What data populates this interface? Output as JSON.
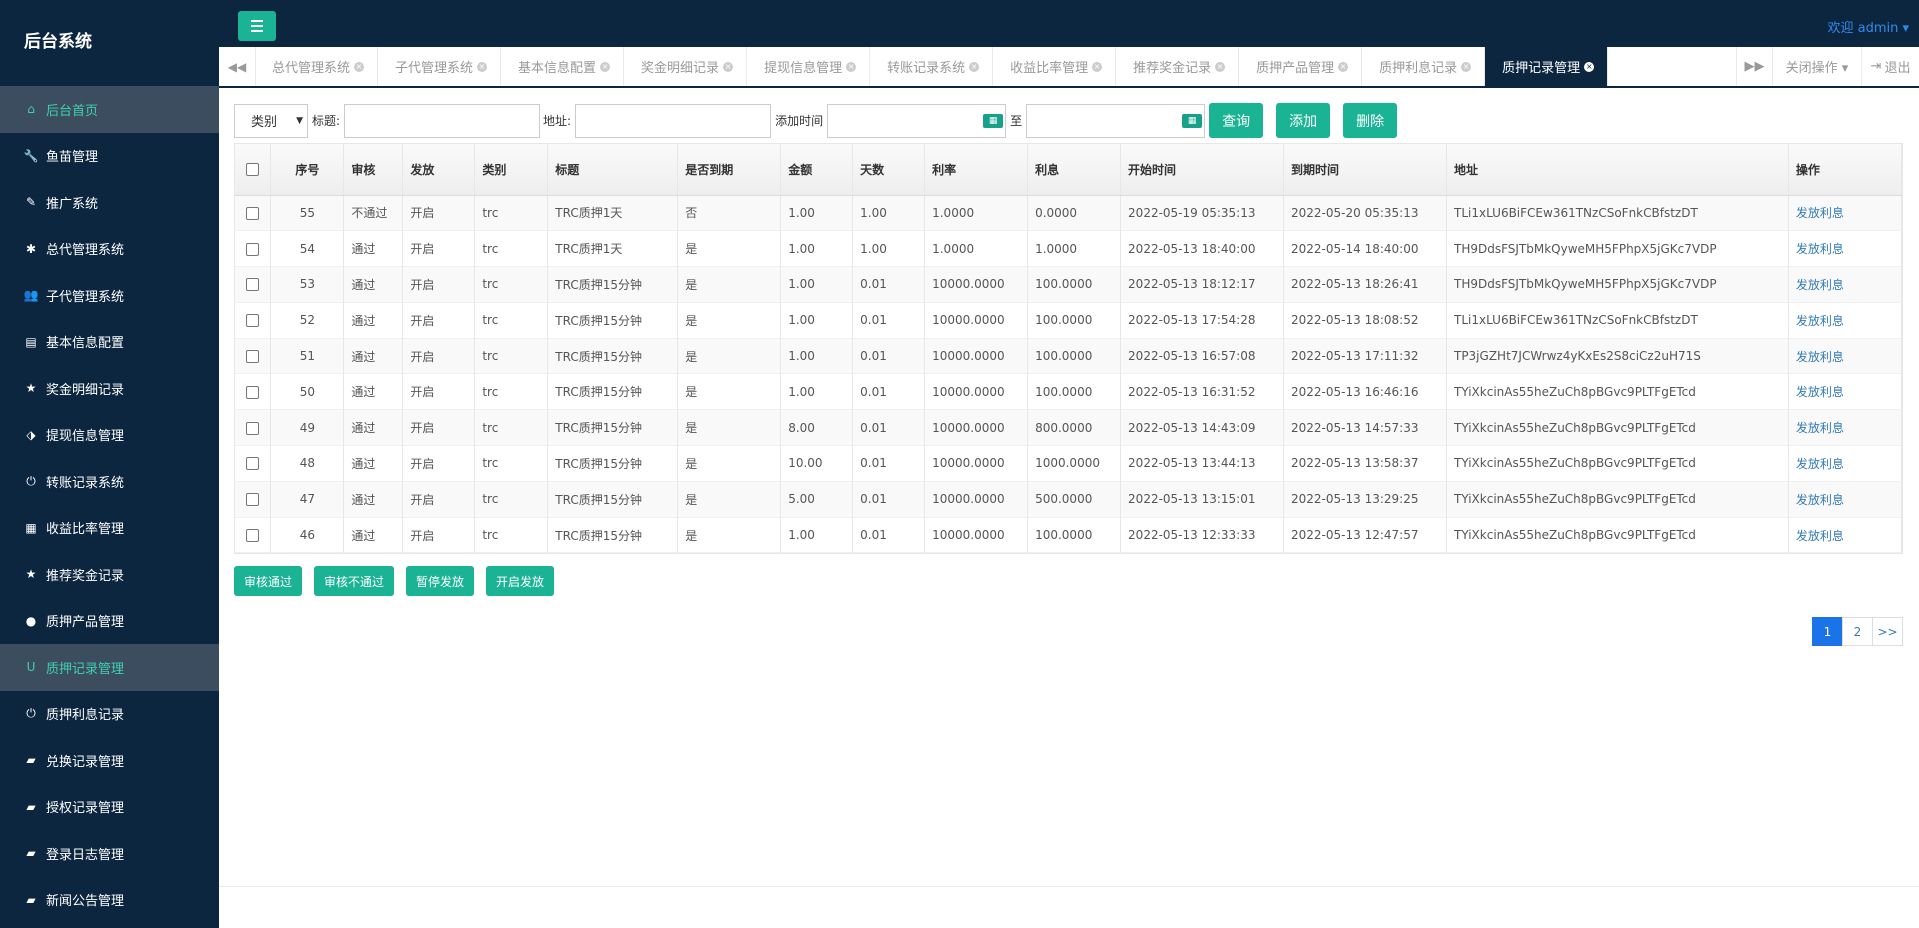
{
  "brand": "后台系统",
  "header": {
    "welcome": "欢迎 admin ▾"
  },
  "sidebar": {
    "items": [
      {
        "label": "后台首页",
        "icon": "home-icon",
        "glyph": "⌂",
        "active": true
      },
      {
        "label": "鱼苗管理",
        "icon": "wrench-icon",
        "glyph": "🔧",
        "active": false
      },
      {
        "label": "推广系统",
        "icon": "edit-icon",
        "glyph": "✎",
        "active": false
      },
      {
        "label": "总代管理系统",
        "icon": "asterisk-icon",
        "glyph": "✱",
        "active": false
      },
      {
        "label": "子代管理系统",
        "icon": "users-icon",
        "glyph": "👥",
        "active": false
      },
      {
        "label": "基本信息配置",
        "icon": "document-icon",
        "glyph": "▤",
        "active": false
      },
      {
        "label": "奖金明细记录",
        "icon": "star-icon",
        "glyph": "★",
        "active": false
      },
      {
        "label": "提现信息管理",
        "icon": "tag-icon",
        "glyph": "⬗",
        "active": false
      },
      {
        "label": "转账记录系统",
        "icon": "power-icon",
        "glyph": "⏻",
        "active": false
      },
      {
        "label": "收益比率管理",
        "icon": "calendar-icon",
        "glyph": "▦",
        "active": false
      },
      {
        "label": "推荐奖金记录",
        "icon": "star-icon",
        "glyph": "★",
        "active": false
      },
      {
        "label": "质押产品管理",
        "icon": "comment-icon",
        "glyph": "●",
        "active": false
      },
      {
        "label": "质押记录管理",
        "icon": "magnet-icon",
        "glyph": "U",
        "active": true
      },
      {
        "label": "质押利息记录",
        "icon": "power-icon",
        "glyph": "⏻",
        "active": false
      },
      {
        "label": "兑换记录管理",
        "icon": "book-icon",
        "glyph": "▰",
        "active": false
      },
      {
        "label": "授权记录管理",
        "icon": "book-icon",
        "glyph": "▰",
        "active": false
      },
      {
        "label": "登录日志管理",
        "icon": "book-icon",
        "glyph": "▰",
        "active": false
      },
      {
        "label": "新闻公告管理",
        "icon": "book-icon",
        "glyph": "▰",
        "active": false
      }
    ]
  },
  "tabs": [
    {
      "label": "总代管理系统",
      "active": false
    },
    {
      "label": "子代管理系统",
      "active": false
    },
    {
      "label": "基本信息配置",
      "active": false
    },
    {
      "label": "奖金明细记录",
      "active": false
    },
    {
      "label": "提现信息管理",
      "active": false
    },
    {
      "label": "转账记录系统",
      "active": false
    },
    {
      "label": "收益比率管理",
      "active": false
    },
    {
      "label": "推荐奖金记录",
      "active": false
    },
    {
      "label": "质押产品管理",
      "active": false
    },
    {
      "label": "质押利息记录",
      "active": false
    },
    {
      "label": "质押记录管理",
      "active": true
    }
  ],
  "tabbar": {
    "close_ops": "关闭操作 ▾",
    "logout": "退出"
  },
  "filters": {
    "category": "类别",
    "title_label": "标题:",
    "address_label": "地址:",
    "time_label": "添加时间",
    "to_label": "至",
    "query": "查询",
    "add": "添加",
    "delete": "删除"
  },
  "table": {
    "columns": [
      "序号",
      "审核",
      "发放",
      "类别",
      "标题",
      "是否到期",
      "金额",
      "天数",
      "利率",
      "利息",
      "开始时间",
      "到期时间",
      "地址",
      "操作"
    ],
    "rows": [
      [
        "55",
        "不通过",
        "开启",
        "trc",
        "TRC质押1天",
        "否",
        "1.00",
        "1.00",
        "1.0000",
        "0.0000",
        "2022-05-19 05:35:13",
        "2022-05-20 05:35:13",
        "TLi1xLU6BiFCEw361TNzCSoFnkCBfstzDT",
        "发放利息"
      ],
      [
        "54",
        "通过",
        "开启",
        "trc",
        "TRC质押1天",
        "是",
        "1.00",
        "1.00",
        "1.0000",
        "1.0000",
        "2022-05-13 18:40:00",
        "2022-05-14 18:40:00",
        "TH9DdsFSJTbMkQyweMH5FPhpX5jGKc7VDP",
        "发放利息"
      ],
      [
        "53",
        "通过",
        "开启",
        "trc",
        "TRC质押15分钟",
        "是",
        "1.00",
        "0.01",
        "10000.0000",
        "100.0000",
        "2022-05-13 18:12:17",
        "2022-05-13 18:26:41",
        "TH9DdsFSJTbMkQyweMH5FPhpX5jGKc7VDP",
        "发放利息"
      ],
      [
        "52",
        "通过",
        "开启",
        "trc",
        "TRC质押15分钟",
        "是",
        "1.00",
        "0.01",
        "10000.0000",
        "100.0000",
        "2022-05-13 17:54:28",
        "2022-05-13 18:08:52",
        "TLi1xLU6BiFCEw361TNzCSoFnkCBfstzDT",
        "发放利息"
      ],
      [
        "51",
        "通过",
        "开启",
        "trc",
        "TRC质押15分钟",
        "是",
        "1.00",
        "0.01",
        "10000.0000",
        "100.0000",
        "2022-05-13 16:57:08",
        "2022-05-13 17:11:32",
        "TP3jGZHt7JCWrwz4yKxEs2S8ciCz2uH71S",
        "发放利息"
      ],
      [
        "50",
        "通过",
        "开启",
        "trc",
        "TRC质押15分钟",
        "是",
        "1.00",
        "0.01",
        "10000.0000",
        "100.0000",
        "2022-05-13 16:31:52",
        "2022-05-13 16:46:16",
        "TYiXkcinAs55heZuCh8pBGvc9PLTFgETcd",
        "发放利息"
      ],
      [
        "49",
        "通过",
        "开启",
        "trc",
        "TRC质押15分钟",
        "是",
        "8.00",
        "0.01",
        "10000.0000",
        "800.0000",
        "2022-05-13 14:43:09",
        "2022-05-13 14:57:33",
        "TYiXkcinAs55heZuCh8pBGvc9PLTFgETcd",
        "发放利息"
      ],
      [
        "48",
        "通过",
        "开启",
        "trc",
        "TRC质押15分钟",
        "是",
        "10.00",
        "0.01",
        "10000.0000",
        "1000.0000",
        "2022-05-13 13:44:13",
        "2022-05-13 13:58:37",
        "TYiXkcinAs55heZuCh8pBGvc9PLTFgETcd",
        "发放利息"
      ],
      [
        "47",
        "通过",
        "开启",
        "trc",
        "TRC质押15分钟",
        "是",
        "5.00",
        "0.01",
        "10000.0000",
        "500.0000",
        "2022-05-13 13:15:01",
        "2022-05-13 13:29:25",
        "TYiXkcinAs55heZuCh8pBGvc9PLTFgETcd",
        "发放利息"
      ],
      [
        "46",
        "通过",
        "开启",
        "trc",
        "TRC质押15分钟",
        "是",
        "1.00",
        "0.01",
        "10000.0000",
        "100.0000",
        "2022-05-13 12:33:33",
        "2022-05-13 12:47:57",
        "TYiXkcinAs55heZuCh8pBGvc9PLTFgETcd",
        "发放利息"
      ]
    ]
  },
  "actions": [
    "审核通过",
    "审核不通过",
    "暂停发放",
    "开启发放"
  ],
  "pager": {
    "pages": [
      "1",
      "2",
      ">>"
    ],
    "current": "1"
  },
  "colors": {
    "sidebar": "#0c2640",
    "accent": "#1ab394",
    "link": "#337ab7",
    "active_menu": "#3fd1b0"
  }
}
